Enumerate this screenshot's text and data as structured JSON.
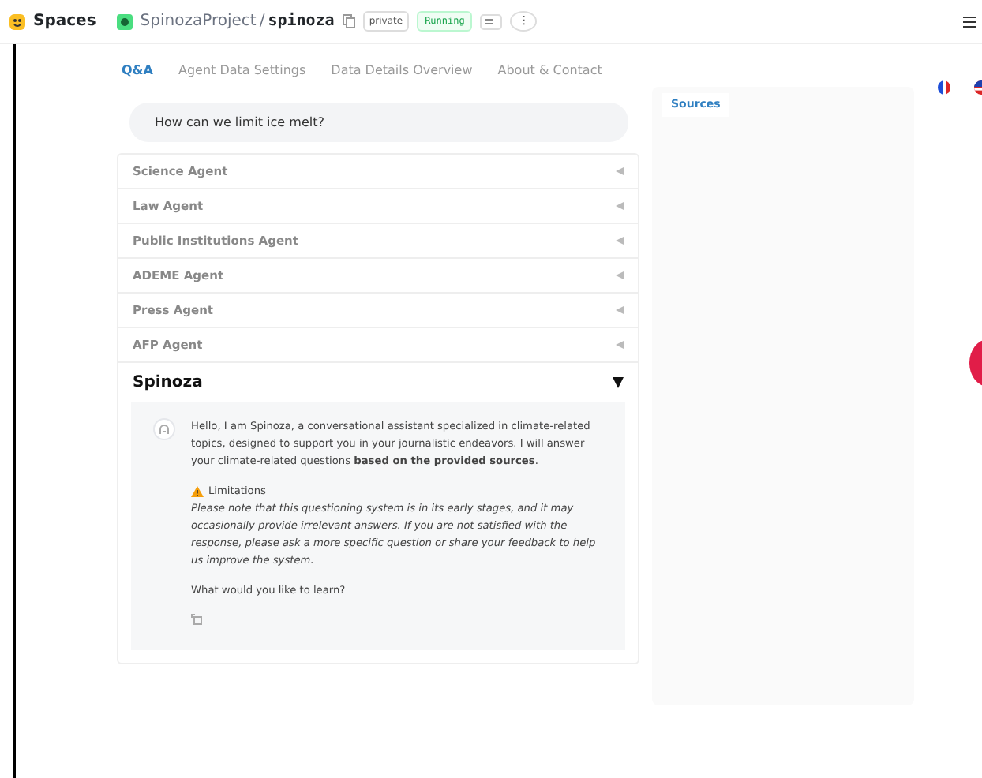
{
  "topbar": {
    "spaces": "Spaces",
    "owner": "SpinozaProject",
    "separator": "/",
    "repo": "spinoza",
    "visibility": "private",
    "status": "Running",
    "menu": "⋮"
  },
  "tabs": [
    {
      "label": "Q&A",
      "selected": true
    },
    {
      "label": "Agent Data Settings",
      "selected": false
    },
    {
      "label": "Data Details Overview",
      "selected": false
    },
    {
      "label": "About & Contact",
      "selected": false
    }
  ],
  "question": {
    "value": "How can we limit ice melt?"
  },
  "agents": [
    {
      "name": "Science Agent",
      "expanded": false
    },
    {
      "name": "Law Agent",
      "expanded": false
    },
    {
      "name": "Public Institutions Agent",
      "expanded": false
    },
    {
      "name": "ADEME Agent",
      "expanded": false
    },
    {
      "name": "Press Agent",
      "expanded": false
    },
    {
      "name": "AFP Agent",
      "expanded": false
    },
    {
      "name": "Spinoza",
      "expanded": true
    }
  ],
  "message": {
    "intro": "Hello, I am Spinoza, a conversational assistant specialized in climate-related topics, designed to support you in your journalistic endeavors. I will answer your climate-related questions **based on the provided sources**.",
    "warning_title": "Limitations",
    "warning": "Please note that this questioning system is in its early stages, and it may occasionally provide irrelevant answers. If you are not satisfied with the response, please ask a more specific question or share your feedback to help us improve the system.",
    "prompt": "What would you like to learn?"
  },
  "sources": {
    "title": "Sources"
  }
}
